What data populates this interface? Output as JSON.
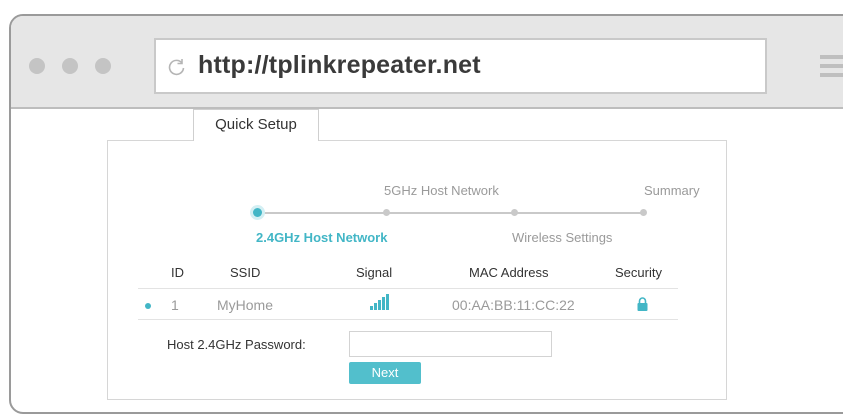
{
  "browser": {
    "url": "http://tplinkrepeater.net"
  },
  "tab": {
    "label": "Quick Setup"
  },
  "stepper": {
    "steps": [
      {
        "label": "2.4GHz Host Network",
        "active": true
      },
      {
        "label": "5GHz Host Network",
        "active": false
      },
      {
        "label": "Wireless Settings",
        "active": false
      },
      {
        "label": "Summary",
        "active": false
      }
    ]
  },
  "table": {
    "headers": [
      "ID",
      "SSID",
      "Signal",
      "MAC Address",
      "Security"
    ],
    "rows": [
      {
        "id": "1",
        "ssid": "MyHome",
        "signal_icon": "signal-strength-icon",
        "mac": "00:AA:BB:11:CC:22",
        "security_icon": "lock-icon",
        "selected": true
      }
    ]
  },
  "password": {
    "label": "Host 2.4GHz Password:",
    "value": "",
    "placeholder": ""
  },
  "next_button": {
    "label": "Next"
  },
  "colors": {
    "accent": "#42b6c6",
    "button": "#52bfcc"
  }
}
